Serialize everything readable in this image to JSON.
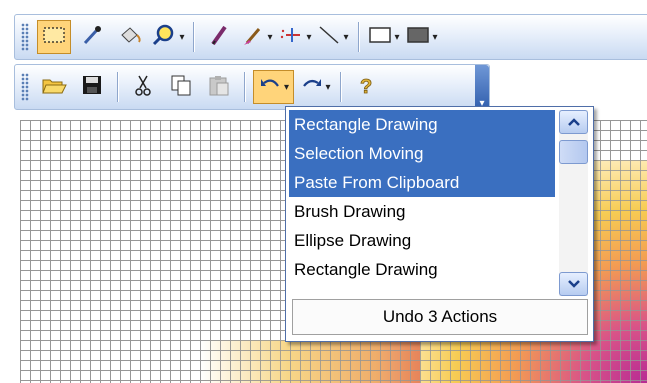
{
  "toolbar1": {
    "buttons": [
      {
        "name": "rectangle-select-icon",
        "selected": true
      },
      {
        "name": "color-picker-icon"
      },
      {
        "name": "fill-bucket-icon"
      },
      {
        "name": "zoom-icon",
        "dropdown": true
      },
      {
        "name": "pencil-icon"
      },
      {
        "name": "brush-icon",
        "dropdown": true
      },
      {
        "name": "spray-icon",
        "dropdown": true
      },
      {
        "name": "line-icon",
        "dropdown": true
      },
      {
        "name": "rectangle-outline-icon",
        "dropdown": true
      },
      {
        "name": "rectangle-filled-icon",
        "dropdown": true
      }
    ]
  },
  "toolbar2": {
    "buttons": [
      {
        "name": "open-folder-icon"
      },
      {
        "name": "save-icon"
      },
      {
        "name": "cut-icon"
      },
      {
        "name": "copy-icon"
      },
      {
        "name": "paste-icon",
        "disabled": true
      },
      {
        "name": "undo-icon",
        "dropdown": true
      },
      {
        "name": "redo-icon",
        "dropdown": true
      },
      {
        "name": "help-icon"
      }
    ]
  },
  "undo_list": {
    "items": [
      {
        "label": "Rectangle Drawing",
        "selected": true
      },
      {
        "label": "Selection Moving",
        "selected": true
      },
      {
        "label": "Paste From Clipboard",
        "selected": true
      },
      {
        "label": "Brush Drawing",
        "selected": false
      },
      {
        "label": "Ellipse Drawing",
        "selected": false
      },
      {
        "label": "Rectangle Drawing",
        "selected": false
      }
    ],
    "footer": "Undo 3 Actions"
  },
  "colors": {
    "highlight": "#3a6fc0",
    "selected_tool": "#ffd47a"
  }
}
